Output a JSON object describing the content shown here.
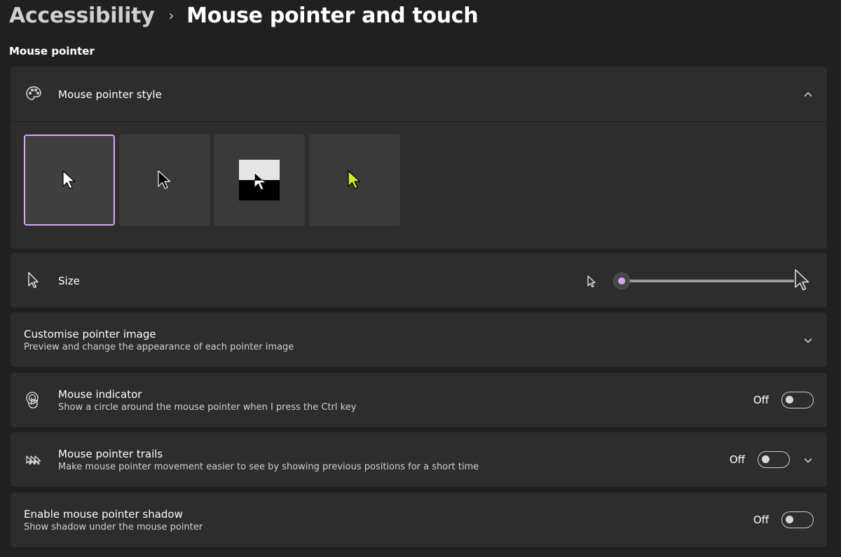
{
  "breadcrumb": {
    "parent": "Accessibility",
    "separator": "›",
    "current": "Mouse pointer and touch"
  },
  "section_label": "Mouse pointer",
  "pointer_style": {
    "title": "Mouse pointer style",
    "icon": "palette-icon",
    "expanded": true,
    "options": [
      {
        "name": "white",
        "selected": true
      },
      {
        "name": "black",
        "selected": false
      },
      {
        "name": "inverted",
        "selected": false
      },
      {
        "name": "custom",
        "selected": false,
        "color": "#c6f01e"
      }
    ],
    "accent": "#d9a6f0"
  },
  "size": {
    "title": "Size",
    "icon": "cursor-icon",
    "value": 1,
    "min": 1,
    "max": 15
  },
  "customise": {
    "title": "Customise pointer image",
    "subtitle": "Preview and change the appearance of each pointer image"
  },
  "mouse_indicator": {
    "title": "Mouse indicator",
    "subtitle": "Show a circle around the mouse pointer when I press the Ctrl key",
    "icon": "touch-indicator-icon",
    "state_label": "Off"
  },
  "pointer_trails": {
    "title": "Mouse pointer trails",
    "subtitle": "Make mouse pointer movement easier to see by showing previous positions for a short time",
    "icon": "pointer-trails-icon",
    "state_label": "Off"
  },
  "pointer_shadow": {
    "title": "Enable mouse pointer shadow",
    "subtitle": "Show shadow under the mouse pointer",
    "state_label": "Off"
  }
}
